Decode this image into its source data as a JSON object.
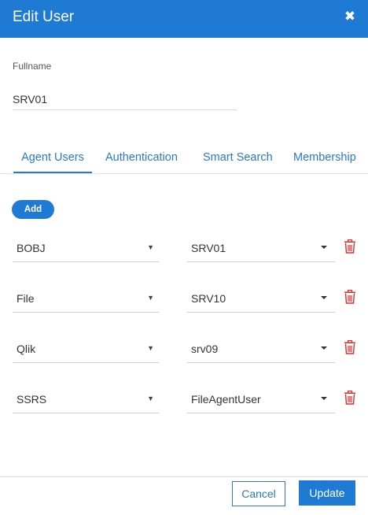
{
  "dialog": {
    "title": "Edit User",
    "close_icon": "close-icon",
    "accent_color": "#1f7ad4",
    "delete_color": "#d9302f"
  },
  "form": {
    "fullname_label": "Fullname",
    "fullname_value": "SRV01"
  },
  "tabs": [
    {
      "label": "Agent Users",
      "active": true
    },
    {
      "label": "Authentication",
      "active": false
    },
    {
      "label": "Smart Search",
      "active": false
    },
    {
      "label": "Membership",
      "active": false
    }
  ],
  "agent_users": {
    "add_label": "Add",
    "rows": [
      {
        "type": "BOBJ",
        "user": "SRV01"
      },
      {
        "type": "File",
        "user": "SRV10"
      },
      {
        "type": "Qlik",
        "user": "srv09"
      },
      {
        "type": "SSRS",
        "user": "FileAgentUser"
      }
    ],
    "delete_icon": "trash-icon"
  },
  "footer": {
    "cancel_label": "Cancel",
    "update_label": "Update"
  }
}
